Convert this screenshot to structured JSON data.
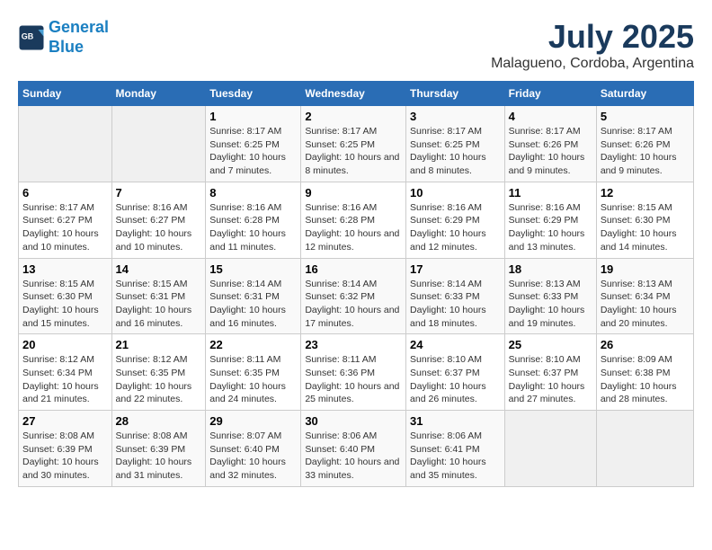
{
  "header": {
    "logo_line1": "General",
    "logo_line2": "Blue",
    "title": "July 2025",
    "subtitle": "Malagueno, Cordoba, Argentina"
  },
  "days_of_week": [
    "Sunday",
    "Monday",
    "Tuesday",
    "Wednesday",
    "Thursday",
    "Friday",
    "Saturday"
  ],
  "weeks": [
    [
      {
        "day": "",
        "sunrise": "",
        "sunset": "",
        "daylight": ""
      },
      {
        "day": "",
        "sunrise": "",
        "sunset": "",
        "daylight": ""
      },
      {
        "day": "1",
        "sunrise": "Sunrise: 8:17 AM",
        "sunset": "Sunset: 6:25 PM",
        "daylight": "Daylight: 10 hours and 7 minutes."
      },
      {
        "day": "2",
        "sunrise": "Sunrise: 8:17 AM",
        "sunset": "Sunset: 6:25 PM",
        "daylight": "Daylight: 10 hours and 8 minutes."
      },
      {
        "day": "3",
        "sunrise": "Sunrise: 8:17 AM",
        "sunset": "Sunset: 6:25 PM",
        "daylight": "Daylight: 10 hours and 8 minutes."
      },
      {
        "day": "4",
        "sunrise": "Sunrise: 8:17 AM",
        "sunset": "Sunset: 6:26 PM",
        "daylight": "Daylight: 10 hours and 9 minutes."
      },
      {
        "day": "5",
        "sunrise": "Sunrise: 8:17 AM",
        "sunset": "Sunset: 6:26 PM",
        "daylight": "Daylight: 10 hours and 9 minutes."
      }
    ],
    [
      {
        "day": "6",
        "sunrise": "Sunrise: 8:17 AM",
        "sunset": "Sunset: 6:27 PM",
        "daylight": "Daylight: 10 hours and 10 minutes."
      },
      {
        "day": "7",
        "sunrise": "Sunrise: 8:16 AM",
        "sunset": "Sunset: 6:27 PM",
        "daylight": "Daylight: 10 hours and 10 minutes."
      },
      {
        "day": "8",
        "sunrise": "Sunrise: 8:16 AM",
        "sunset": "Sunset: 6:28 PM",
        "daylight": "Daylight: 10 hours and 11 minutes."
      },
      {
        "day": "9",
        "sunrise": "Sunrise: 8:16 AM",
        "sunset": "Sunset: 6:28 PM",
        "daylight": "Daylight: 10 hours and 12 minutes."
      },
      {
        "day": "10",
        "sunrise": "Sunrise: 8:16 AM",
        "sunset": "Sunset: 6:29 PM",
        "daylight": "Daylight: 10 hours and 12 minutes."
      },
      {
        "day": "11",
        "sunrise": "Sunrise: 8:16 AM",
        "sunset": "Sunset: 6:29 PM",
        "daylight": "Daylight: 10 hours and 13 minutes."
      },
      {
        "day": "12",
        "sunrise": "Sunrise: 8:15 AM",
        "sunset": "Sunset: 6:30 PM",
        "daylight": "Daylight: 10 hours and 14 minutes."
      }
    ],
    [
      {
        "day": "13",
        "sunrise": "Sunrise: 8:15 AM",
        "sunset": "Sunset: 6:30 PM",
        "daylight": "Daylight: 10 hours and 15 minutes."
      },
      {
        "day": "14",
        "sunrise": "Sunrise: 8:15 AM",
        "sunset": "Sunset: 6:31 PM",
        "daylight": "Daylight: 10 hours and 16 minutes."
      },
      {
        "day": "15",
        "sunrise": "Sunrise: 8:14 AM",
        "sunset": "Sunset: 6:31 PM",
        "daylight": "Daylight: 10 hours and 16 minutes."
      },
      {
        "day": "16",
        "sunrise": "Sunrise: 8:14 AM",
        "sunset": "Sunset: 6:32 PM",
        "daylight": "Daylight: 10 hours and 17 minutes."
      },
      {
        "day": "17",
        "sunrise": "Sunrise: 8:14 AM",
        "sunset": "Sunset: 6:33 PM",
        "daylight": "Daylight: 10 hours and 18 minutes."
      },
      {
        "day": "18",
        "sunrise": "Sunrise: 8:13 AM",
        "sunset": "Sunset: 6:33 PM",
        "daylight": "Daylight: 10 hours and 19 minutes."
      },
      {
        "day": "19",
        "sunrise": "Sunrise: 8:13 AM",
        "sunset": "Sunset: 6:34 PM",
        "daylight": "Daylight: 10 hours and 20 minutes."
      }
    ],
    [
      {
        "day": "20",
        "sunrise": "Sunrise: 8:12 AM",
        "sunset": "Sunset: 6:34 PM",
        "daylight": "Daylight: 10 hours and 21 minutes."
      },
      {
        "day": "21",
        "sunrise": "Sunrise: 8:12 AM",
        "sunset": "Sunset: 6:35 PM",
        "daylight": "Daylight: 10 hours and 22 minutes."
      },
      {
        "day": "22",
        "sunrise": "Sunrise: 8:11 AM",
        "sunset": "Sunset: 6:35 PM",
        "daylight": "Daylight: 10 hours and 24 minutes."
      },
      {
        "day": "23",
        "sunrise": "Sunrise: 8:11 AM",
        "sunset": "Sunset: 6:36 PM",
        "daylight": "Daylight: 10 hours and 25 minutes."
      },
      {
        "day": "24",
        "sunrise": "Sunrise: 8:10 AM",
        "sunset": "Sunset: 6:37 PM",
        "daylight": "Daylight: 10 hours and 26 minutes."
      },
      {
        "day": "25",
        "sunrise": "Sunrise: 8:10 AM",
        "sunset": "Sunset: 6:37 PM",
        "daylight": "Daylight: 10 hours and 27 minutes."
      },
      {
        "day": "26",
        "sunrise": "Sunrise: 8:09 AM",
        "sunset": "Sunset: 6:38 PM",
        "daylight": "Daylight: 10 hours and 28 minutes."
      }
    ],
    [
      {
        "day": "27",
        "sunrise": "Sunrise: 8:08 AM",
        "sunset": "Sunset: 6:39 PM",
        "daylight": "Daylight: 10 hours and 30 minutes."
      },
      {
        "day": "28",
        "sunrise": "Sunrise: 8:08 AM",
        "sunset": "Sunset: 6:39 PM",
        "daylight": "Daylight: 10 hours and 31 minutes."
      },
      {
        "day": "29",
        "sunrise": "Sunrise: 8:07 AM",
        "sunset": "Sunset: 6:40 PM",
        "daylight": "Daylight: 10 hours and 32 minutes."
      },
      {
        "day": "30",
        "sunrise": "Sunrise: 8:06 AM",
        "sunset": "Sunset: 6:40 PM",
        "daylight": "Daylight: 10 hours and 33 minutes."
      },
      {
        "day": "31",
        "sunrise": "Sunrise: 8:06 AM",
        "sunset": "Sunset: 6:41 PM",
        "daylight": "Daylight: 10 hours and 35 minutes."
      },
      {
        "day": "",
        "sunrise": "",
        "sunset": "",
        "daylight": ""
      },
      {
        "day": "",
        "sunrise": "",
        "sunset": "",
        "daylight": ""
      }
    ]
  ]
}
